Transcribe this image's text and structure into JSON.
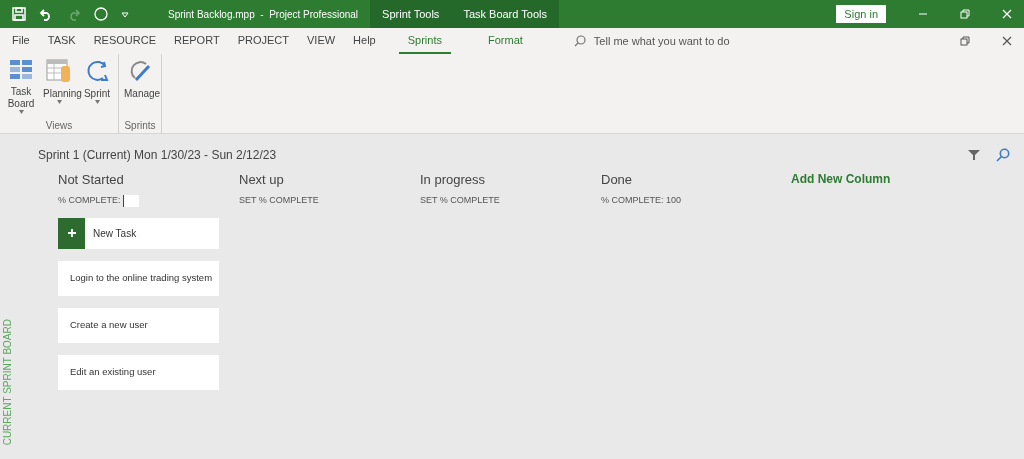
{
  "title_bar": {
    "document_title": "Sprint Backlog.mpp  -  Project Professional",
    "context_tabs": [
      "Sprint Tools",
      "Task Board Tools"
    ],
    "sign_in": "Sign in"
  },
  "menu_tabs": [
    {
      "label": "File",
      "selected": false,
      "kind": "normal"
    },
    {
      "label": "TASK",
      "selected": false,
      "kind": "normal"
    },
    {
      "label": "RESOURCE",
      "selected": false,
      "kind": "normal"
    },
    {
      "label": "REPORT",
      "selected": false,
      "kind": "normal"
    },
    {
      "label": "PROJECT",
      "selected": false,
      "kind": "normal"
    },
    {
      "label": "VIEW",
      "selected": false,
      "kind": "normal"
    },
    {
      "label": "Help",
      "selected": false,
      "kind": "normal"
    },
    {
      "label": "Sprints",
      "selected": true,
      "kind": "context"
    },
    {
      "label": "Format",
      "selected": false,
      "kind": "context"
    }
  ],
  "tell_me": {
    "placeholder": "Tell me what you want to do"
  },
  "ribbon_groups": [
    {
      "label": "Views",
      "buttons": [
        {
          "kind": "taskboard",
          "label": "Task Board",
          "dropdown": true
        },
        {
          "kind": "planning",
          "label": "Planning",
          "dropdown": true
        },
        {
          "kind": "sprint",
          "label": "Sprint",
          "dropdown": true
        }
      ]
    },
    {
      "label": "Sprints",
      "buttons": [
        {
          "kind": "manage",
          "label": "Manage",
          "dropdown": false
        }
      ]
    }
  ],
  "board": {
    "side_label": "CURRENT SPRINT BOARD",
    "sprint_title": "Sprint 1 (Current) Mon 1/30/23 - Sun 2/12/23",
    "columns": [
      {
        "title": "Not Started",
        "setting": "% COMPLETE:",
        "kind": "field",
        "new_task": "New Task",
        "cards": [
          "Login to the online trading system",
          "Create a new user",
          "Edit an existing user"
        ]
      },
      {
        "title": "Next up",
        "setting": "SET % COMPLETE",
        "kind": "link"
      },
      {
        "title": "In progress",
        "setting": "SET % COMPLETE",
        "kind": "link"
      },
      {
        "title": "Done",
        "setting": "% COMPLETE: 100",
        "kind": "text"
      }
    ],
    "add_column": "Add New Column"
  }
}
